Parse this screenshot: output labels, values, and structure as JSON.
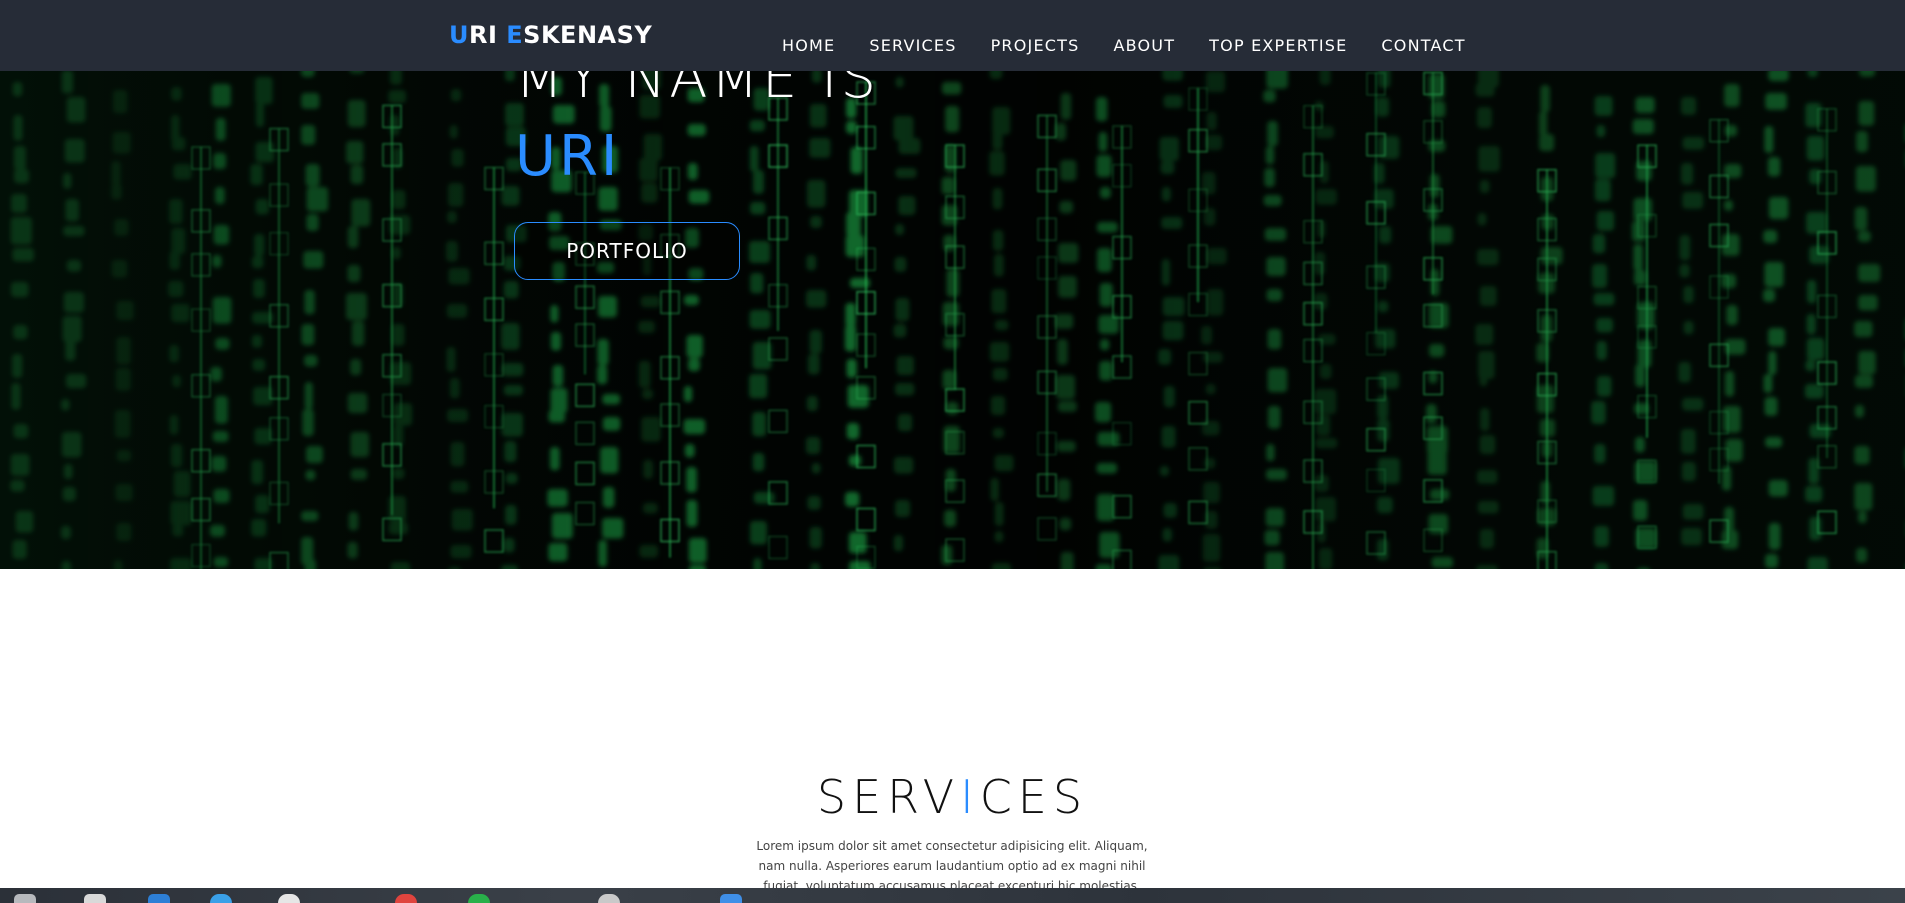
{
  "brand": {
    "first_initial": "U",
    "first_rest": "RI ",
    "last_initial": "E",
    "last_rest": "SKENASY"
  },
  "nav": {
    "items": [
      {
        "label": "HOME"
      },
      {
        "label": "SERVICES"
      },
      {
        "label": "PROJECTS"
      },
      {
        "label": "ABOUT"
      },
      {
        "label": "TOP EXPERTISE"
      },
      {
        "label": "CONTACT"
      }
    ]
  },
  "hero": {
    "title": "MY NAME IS",
    "name": "URI",
    "button_label": "PORTFOLIO"
  },
  "services": {
    "title_part1": "SERV",
    "title_accent": "I",
    "title_part2": "CES",
    "description": "Lorem ipsum dolor sit amet consectetur adipisicing elit. Aliquam, nam nulla. Asperiores earum laudantium optio ad ex magni nihil fugiat, voluptatum accusamus placeat excepturi hic molestias."
  },
  "colors": {
    "navbar_bg": "#262c37",
    "accent": "#2a8cff",
    "hero_bg": "#020503",
    "matrix_green": "#1fae4a"
  },
  "icons": {
    "background": "matrix-code-rain-image"
  }
}
